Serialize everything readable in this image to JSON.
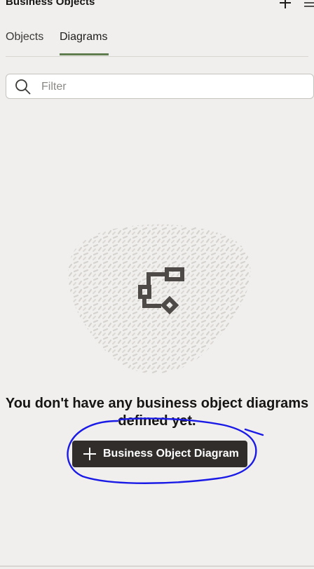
{
  "header": {
    "title": "Business Objects",
    "add_icon": "plus-icon",
    "menu_icon": "hamburger-menu-icon"
  },
  "tabs": [
    {
      "label": "Objects",
      "selected": false
    },
    {
      "label": "Diagrams",
      "selected": true
    }
  ],
  "filter": {
    "placeholder": "Filter",
    "value": "",
    "icon": "search-icon"
  },
  "empty_state": {
    "illustration": "diagram-flow-icon",
    "message": "You don't have any business object diagrams defined yet.",
    "button_label": "Business Object Diagram",
    "button_icon": "plus-icon"
  },
  "colors": {
    "background": "#f1efed",
    "tab_underline": "#5f7d4f",
    "button_bg": "#312d2a",
    "annotation": "#1a1ae6"
  }
}
